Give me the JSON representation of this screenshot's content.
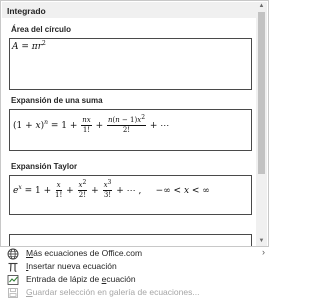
{
  "gallery": {
    "section_title": "Integrado",
    "items": [
      {
        "label": "Área del círculo",
        "equation": "A = πr²"
      },
      {
        "label": "Expansión de una suma",
        "equation": "(1 + x)ⁿ = 1 + nx/1! + n(n−1)x²/2! + ⋯"
      },
      {
        "label": "Expansión Taylor",
        "equation": "eˣ = 1 + x/1! + x²/2! + x³/3! + ⋯,  −∞ < x < ∞"
      }
    ]
  },
  "menu": {
    "items": [
      {
        "pre": "",
        "accel": "M",
        "post": "ás ecuaciones de Office.com",
        "icon": "globe-icon",
        "has_submenu": true,
        "enabled": true
      },
      {
        "pre": "",
        "accel": "I",
        "post": "nsertar nueva ecuación",
        "icon": "pi-icon",
        "has_submenu": false,
        "enabled": true
      },
      {
        "pre": "Entrada de lápiz de ",
        "accel": "e",
        "post": "cuación",
        "icon": "ink-equation-icon",
        "has_submenu": false,
        "enabled": true
      },
      {
        "pre": "",
        "accel": "G",
        "post": "uardar selección en galería de ecuaciones...",
        "icon": "save-to-gallery-icon",
        "has_submenu": false,
        "enabled": false
      }
    ]
  }
}
